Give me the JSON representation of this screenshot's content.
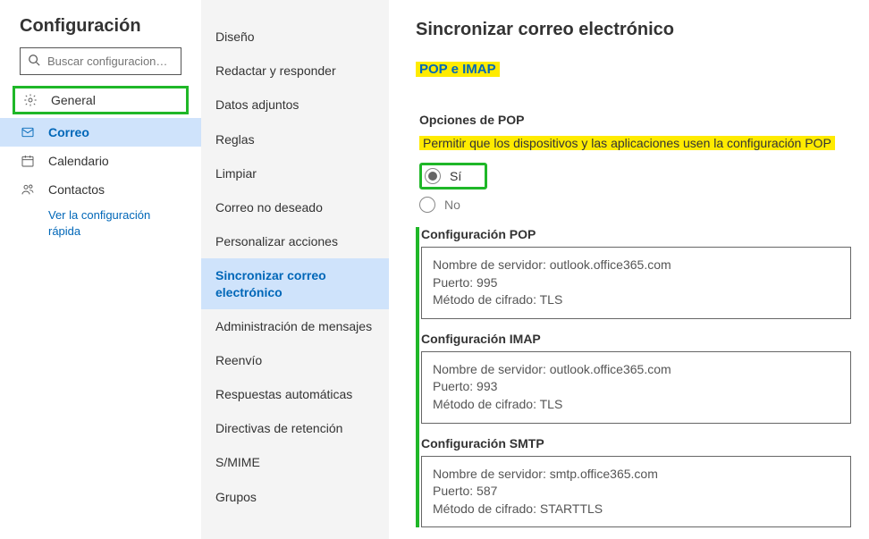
{
  "title": "Configuración",
  "search_placeholder": "Buscar configuracion…",
  "nav": {
    "general": "General",
    "correo": "Correo",
    "calendario": "Calendario",
    "contactos": "Contactos",
    "quick": "Ver la configuración rápida"
  },
  "mid": [
    "Diseño",
    "Redactar y responder",
    "Datos adjuntos",
    "Reglas",
    "Limpiar",
    "Correo no deseado",
    "Personalizar acciones",
    "Sincronizar correo electrónico",
    "Administración de mensajes",
    "Reenvío",
    "Respuestas automáticas",
    "Directivas de retención",
    "S/MIME",
    "Grupos"
  ],
  "right": {
    "title": "Sincronizar correo electrónico",
    "pop_imap": "POP e IMAP",
    "pop_options": "Opciones de POP",
    "pop_allow": "Permitir que los dispositivos y las aplicaciones usen la configuración POP",
    "yes": "Sí",
    "no": "No",
    "conf_pop_title": "Configuración POP",
    "conf_imap_title": "Configuración IMAP",
    "conf_smtp_title": "Configuración SMTP",
    "pop": {
      "server_label": "Nombre de servidor:",
      "server": "outlook.office365.com",
      "port_label": "Puerto:",
      "port": "995",
      "enc_label": "Método de cifrado:",
      "enc": "TLS"
    },
    "imap": {
      "server_label": "Nombre de servidor:",
      "server": "outlook.office365.com",
      "port_label": "Puerto:",
      "port": "993",
      "enc_label": "Método de cifrado:",
      "enc": "TLS"
    },
    "smtp": {
      "server_label": "Nombre de servidor:",
      "server": "smtp.office365.com",
      "port_label": "Puerto:",
      "port": "587",
      "enc_label": "Método de cifrado:",
      "enc": "STARTTLS"
    }
  }
}
